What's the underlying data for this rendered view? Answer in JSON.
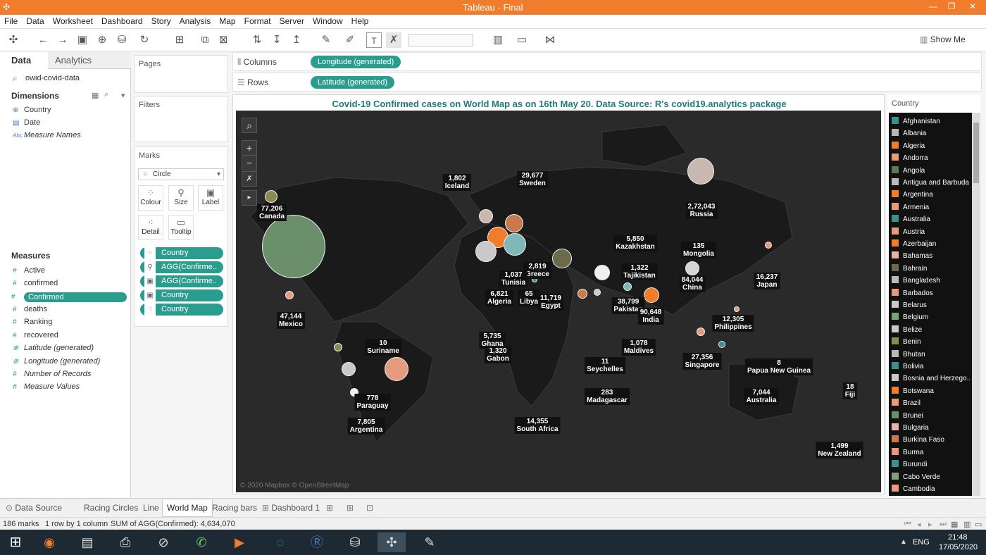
{
  "window": {
    "title": "Tableau - Final"
  },
  "menu": [
    "File",
    "Data",
    "Worksheet",
    "Dashboard",
    "Story",
    "Analysis",
    "Map",
    "Format",
    "Server",
    "Window",
    "Help"
  ],
  "toolbar": {
    "show_me": "Show Me"
  },
  "data_pane": {
    "tabs": [
      "Data",
      "Analytics"
    ],
    "datasource": "owid-covid-data",
    "dimensions_title": "Dimensions",
    "dimensions": [
      "Country",
      "Date",
      "Measure Names"
    ],
    "measures_title": "Measures",
    "measures": [
      "Active",
      "confirmed",
      "Confirmed",
      "deaths",
      "Ranking",
      "recovered",
      "Latitude (generated)",
      "Longitude (generated)",
      "Number of Records",
      "Measure Values"
    ]
  },
  "shelves": {
    "pages_title": "Pages",
    "filters_title": "Filters",
    "marks_title": "Marks",
    "mark_type": "Circle",
    "mark_buttons": [
      "Colour",
      "Size",
      "Label",
      "Detail",
      "Tooltip"
    ],
    "mark_pills": [
      "Country",
      "AGG(Confirme..",
      "AGG(Confirme..",
      "Country",
      "Country"
    ],
    "columns_label": "Columns",
    "columns_pill": "Longitude (generated)",
    "rows_label": "Rows",
    "rows_pill": "Latitude (generated)"
  },
  "viz": {
    "title": "Covid-19 Confirmed cases on World Map as on 16th May 20. Data Source: R's covid19.analytics package",
    "attribution": "© 2020 Mapbox © OpenStreetMap",
    "labels": [
      {
        "name": "Iceland",
        "value": "1,802"
      },
      {
        "name": "Sweden",
        "value": "29,677"
      },
      {
        "name": "Russia",
        "value": "2,72,043"
      },
      {
        "name": "Canada",
        "value": "77,206"
      },
      {
        "name": "Kazakhstan",
        "value": "5,850"
      },
      {
        "name": "Mongolia",
        "value": "135"
      },
      {
        "name": "Greece",
        "value": "2,819"
      },
      {
        "name": "Tunisia",
        "value": "1,037"
      },
      {
        "name": "Tajikistan",
        "value": "1,322"
      },
      {
        "name": "China",
        "value": "84,044"
      },
      {
        "name": "Japan",
        "value": "16,237"
      },
      {
        "name": "Algeria",
        "value": "6,821"
      },
      {
        "name": "Libya",
        "value": "65"
      },
      {
        "name": "Egypt",
        "value": "11,719"
      },
      {
        "name": "Pakistan",
        "value": "38,799"
      },
      {
        "name": "India",
        "value": "90,648"
      },
      {
        "name": "Mexico",
        "value": "47,144"
      },
      {
        "name": "Philippines",
        "value": "12,305"
      },
      {
        "name": "Ghana",
        "value": "5,735"
      },
      {
        "name": "Maldives",
        "value": "1,078"
      },
      {
        "name": "Suriname",
        "value": "10"
      },
      {
        "name": "Gabon",
        "value": "1,320"
      },
      {
        "name": "Singapore",
        "value": "27,356"
      },
      {
        "name": "Papua New Guinea",
        "value": "8"
      },
      {
        "name": "Seychelles",
        "value": "11"
      },
      {
        "name": "Fiji",
        "value": "18"
      },
      {
        "name": "Paraguay",
        "value": "778"
      },
      {
        "name": "Madagascar",
        "value": "283"
      },
      {
        "name": "Australia",
        "value": "7,044"
      },
      {
        "name": "Argentina",
        "value": "7,805"
      },
      {
        "name": "South Africa",
        "value": "14,355"
      },
      {
        "name": "New Zealand",
        "value": "1,499"
      }
    ]
  },
  "legend": {
    "title": "Country",
    "items": [
      {
        "label": "Afghanistan",
        "color": "#3d8f8a"
      },
      {
        "label": "Albania",
        "color": "#b7b7b7"
      },
      {
        "label": "Algeria",
        "color": "#f07c2c"
      },
      {
        "label": "Andorra",
        "color": "#e79a7d"
      },
      {
        "label": "Angola",
        "color": "#5c7a55"
      },
      {
        "label": "Antigua and Barbuda",
        "color": "#b9b9b9"
      },
      {
        "label": "Argentina",
        "color": "#f07c2c"
      },
      {
        "label": "Armenia",
        "color": "#e79a7d"
      },
      {
        "label": "Australia",
        "color": "#3d8f8a"
      },
      {
        "label": "Austria",
        "color": "#e79a7d"
      },
      {
        "label": "Azerbaijan",
        "color": "#f07c2c"
      },
      {
        "label": "Bahamas",
        "color": "#e6b4a5"
      },
      {
        "label": "Bahrain",
        "color": "#6b6b4a"
      },
      {
        "label": "Bangladesh",
        "color": "#b9b9b9"
      },
      {
        "label": "Barbados",
        "color": "#e79a7d"
      },
      {
        "label": "Belarus",
        "color": "#c9c9c9"
      },
      {
        "label": "Belgium",
        "color": "#7aa37a"
      },
      {
        "label": "Belize",
        "color": "#c9c9c9"
      },
      {
        "label": "Benin",
        "color": "#8a8a55"
      },
      {
        "label": "Bhutan",
        "color": "#b9b9b9"
      },
      {
        "label": "Bolivia",
        "color": "#3d8f8a"
      },
      {
        "label": "Bosnia and Herzego..",
        "color": "#c9c9c9"
      },
      {
        "label": "Botswana",
        "color": "#f07c2c"
      },
      {
        "label": "Brazil",
        "color": "#e79a7d"
      },
      {
        "label": "Brunei",
        "color": "#6b8f6b"
      },
      {
        "label": "Bulgaria",
        "color": "#e6b4a5"
      },
      {
        "label": "Burkina Faso",
        "color": "#c87a4a"
      },
      {
        "label": "Burma",
        "color": "#e79a7d"
      },
      {
        "label": "Burundi",
        "color": "#3d8f8a"
      },
      {
        "label": "Cabo Verde",
        "color": "#7aa37a"
      },
      {
        "label": "Cambodia",
        "color": "#e79a7d"
      }
    ]
  },
  "sheets": {
    "tabs": [
      "Data Source",
      "Racing Circles",
      "Line",
      "World Map",
      "Racing bars",
      "Dashboard 1"
    ],
    "active": "World Map"
  },
  "status": {
    "marks": "186 marks",
    "rows_cols": "1 row by 1 column",
    "sum": "SUM of AGG(Confirmed): 4,634,070"
  },
  "taskbar": {
    "lang": "ENG",
    "time": "21:48",
    "date": "17/05/2020"
  }
}
